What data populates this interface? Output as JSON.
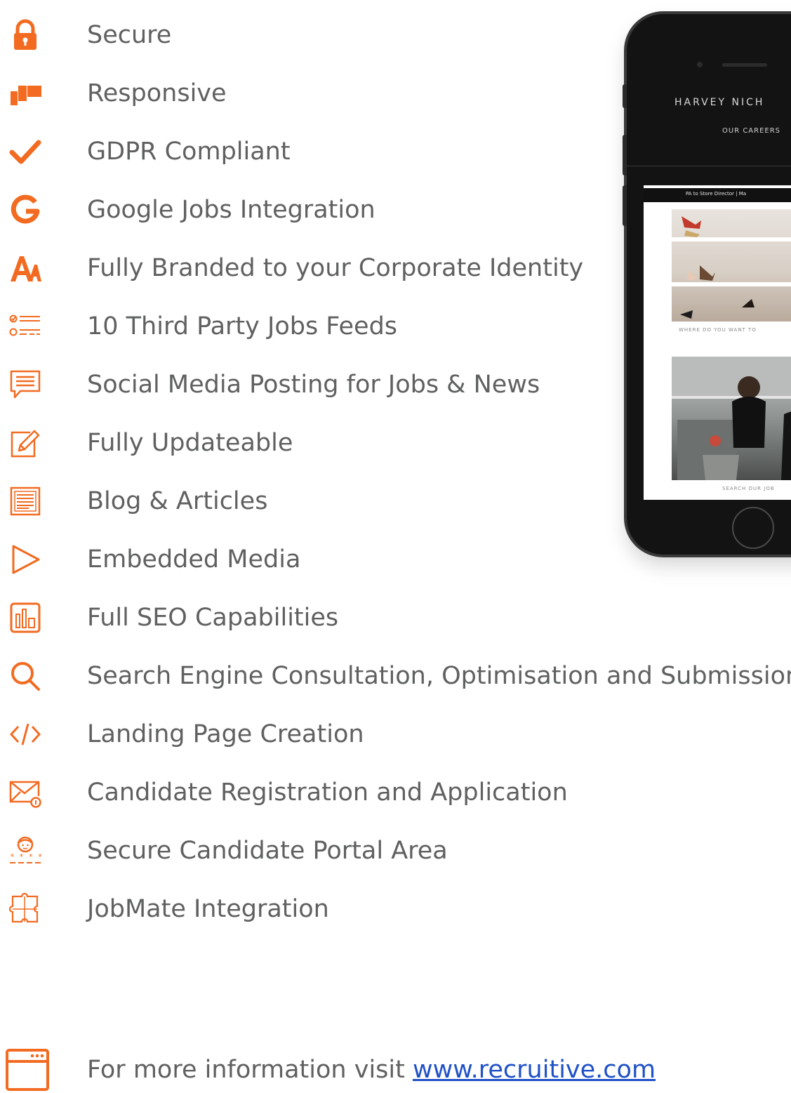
{
  "accent_color": "#f26b21",
  "text_color": "#5f6160",
  "link_color": "#1f51c7",
  "features": [
    {
      "label": "Secure",
      "icon": "padlock-icon"
    },
    {
      "label": "Responsive",
      "icon": "responsive-devices-icon"
    },
    {
      "label": "GDPR Compliant",
      "icon": "checkmark-icon"
    },
    {
      "label": "Google Jobs Integration",
      "icon": "google-g-icon"
    },
    {
      "label": "Fully Branded to your Corporate Identity",
      "icon": "font-branding-icon"
    },
    {
      "label": "10 Third Party Jobs Feeds",
      "icon": "checklist-icon"
    },
    {
      "label": "Social Media Posting for Jobs & News",
      "icon": "speech-bubble-icon"
    },
    {
      "label": "Fully Updateable",
      "icon": "edit-pencil-icon"
    },
    {
      "label": "Blog & Articles",
      "icon": "article-icon"
    },
    {
      "label": "Embedded Media",
      "icon": "play-icon"
    },
    {
      "label": "Full SEO Capabilities",
      "icon": "bar-chart-icon"
    },
    {
      "label": "Search Engine Consultation, Optimisation and Submission",
      "icon": "magnifier-icon"
    },
    {
      "label": "Landing Page Creation",
      "icon": "code-icon"
    },
    {
      "label": "Candidate Registration and Application",
      "icon": "envelope-icon"
    },
    {
      "label": "Secure Candidate Portal Area",
      "icon": "user-password-icon"
    },
    {
      "label": "JobMate Integration",
      "icon": "puzzle-icon"
    }
  ],
  "phone": {
    "brand": "HARVEY NICH",
    "careers": "OUR CAREERS",
    "job_bar": "PA to Store Director | Ma",
    "caption_1": "WHERE DO YOU WANT TO",
    "caption_2": "SEARCH OUR JOB"
  },
  "footer": {
    "text": "For more information visit ",
    "link": "www.recruitive.com",
    "icon": "browser-window-icon"
  }
}
